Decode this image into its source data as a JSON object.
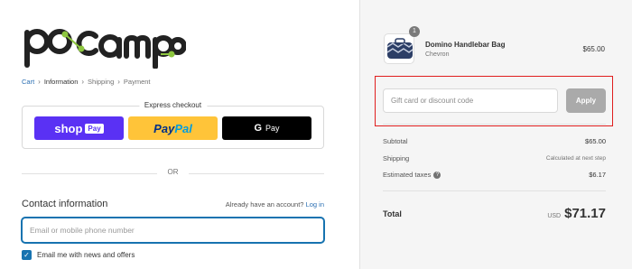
{
  "brand": {
    "name": "pocampo",
    "primary_color": "#222222",
    "accent_color": "#8dc63f"
  },
  "breadcrumb": [
    {
      "label": "Cart"
    },
    {
      "label": "Information"
    },
    {
      "label": "Shipping"
    },
    {
      "label": "Payment"
    }
  ],
  "express": {
    "title": "Express checkout",
    "shop_pay_label": "shop",
    "shop_pay_badge": "Pay",
    "paypal_label_1": "Pay",
    "paypal_label_2": "Pal",
    "gpay_g": "G",
    "gpay_label": "Pay"
  },
  "divider_label": "OR",
  "contact": {
    "title": "Contact information",
    "have_account": "Already have an account?",
    "login_label": "Log in",
    "email_placeholder": "Email or mobile phone number",
    "email_value": "",
    "newsletter_label": "Email me with news and offers",
    "newsletter_checked": true
  },
  "order": {
    "product": {
      "name": "Domino Handlebar Bag",
      "variant": "Chevron",
      "price": "$65.00",
      "quantity": "1"
    },
    "discount_placeholder": "Gift card or discount code",
    "apply_label": "Apply",
    "subtotal_label": "Subtotal",
    "subtotal_value": "$65.00",
    "shipping_label": "Shipping",
    "shipping_value": "Calculated at next step",
    "taxes_label": "Estimated taxes",
    "taxes_value": "$6.17",
    "total_label": "Total",
    "currency": "USD",
    "total_value": "$71.17"
  }
}
